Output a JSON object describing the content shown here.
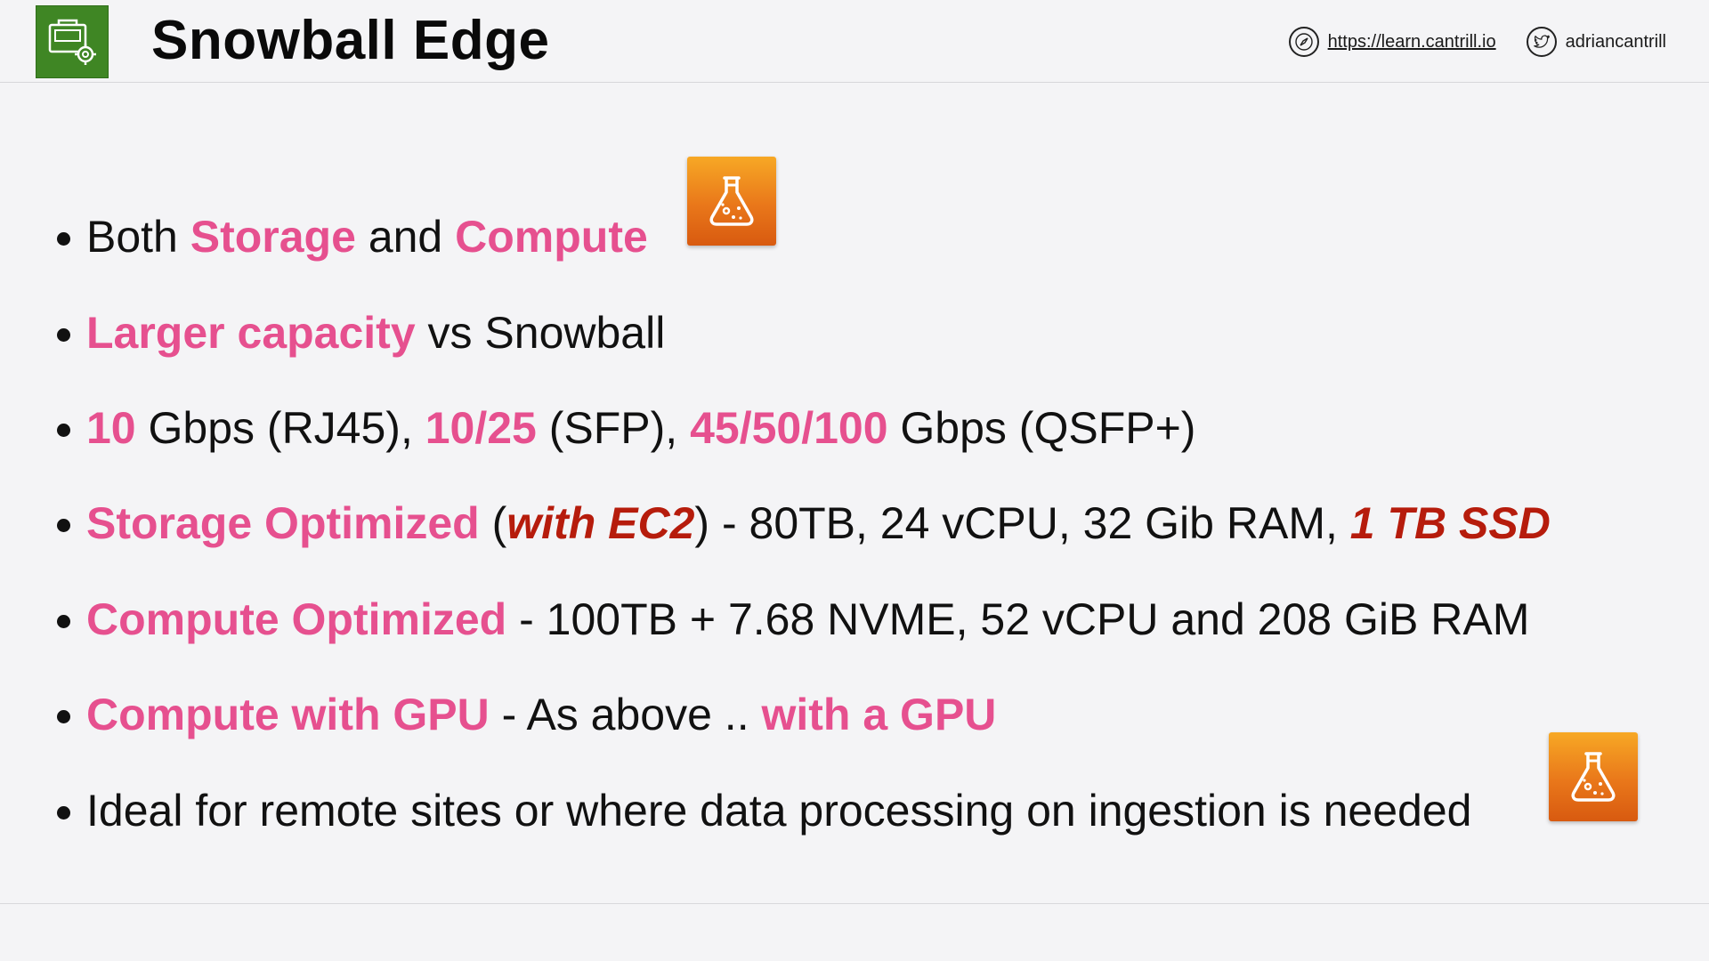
{
  "header": {
    "title": "Snowball Edge",
    "logo_icon": "snowball-edge-icon",
    "website_icon": "compass-icon",
    "website_url": "https://learn.cantrill.io",
    "twitter_icon": "twitter-bird-icon",
    "twitter_handle": "adriancantrill"
  },
  "colors": {
    "highlight_pink": "#e6508f",
    "highlight_red": "#b61c0c",
    "logo_green": "#3f8624",
    "flask_orange": "#ec7a1a"
  },
  "bullets": [
    {
      "parts": [
        "Both ",
        "Storage",
        " and ",
        "Compute"
      ],
      "has_flask_icon": true
    },
    {
      "parts": [
        "Larger capacity",
        " vs Snowball"
      ]
    },
    {
      "parts": [
        "10",
        " Gbps (RJ45), ",
        "10/25",
        " (SFP), ",
        "45/50/100",
        " Gbps (QSFP+)"
      ]
    },
    {
      "parts": [
        "Storage Optimized",
        " (",
        "with EC2",
        ") - 80TB, 24 vCPU, 32 Gib RAM, ",
        "1 TB SSD"
      ]
    },
    {
      "parts": [
        "Compute Optimized",
        " - 100TB + 7.68 NVME, 52 vCPU and 208 GiB RAM"
      ]
    },
    {
      "parts": [
        "Compute with GPU",
        " - As above .. ",
        "with a GPU"
      ]
    },
    {
      "parts": [
        "Ideal for remote sites or where data processing on ingestion is needed"
      ],
      "has_flask_icon": true
    }
  ],
  "icons": {
    "flask": "flask-icon"
  }
}
